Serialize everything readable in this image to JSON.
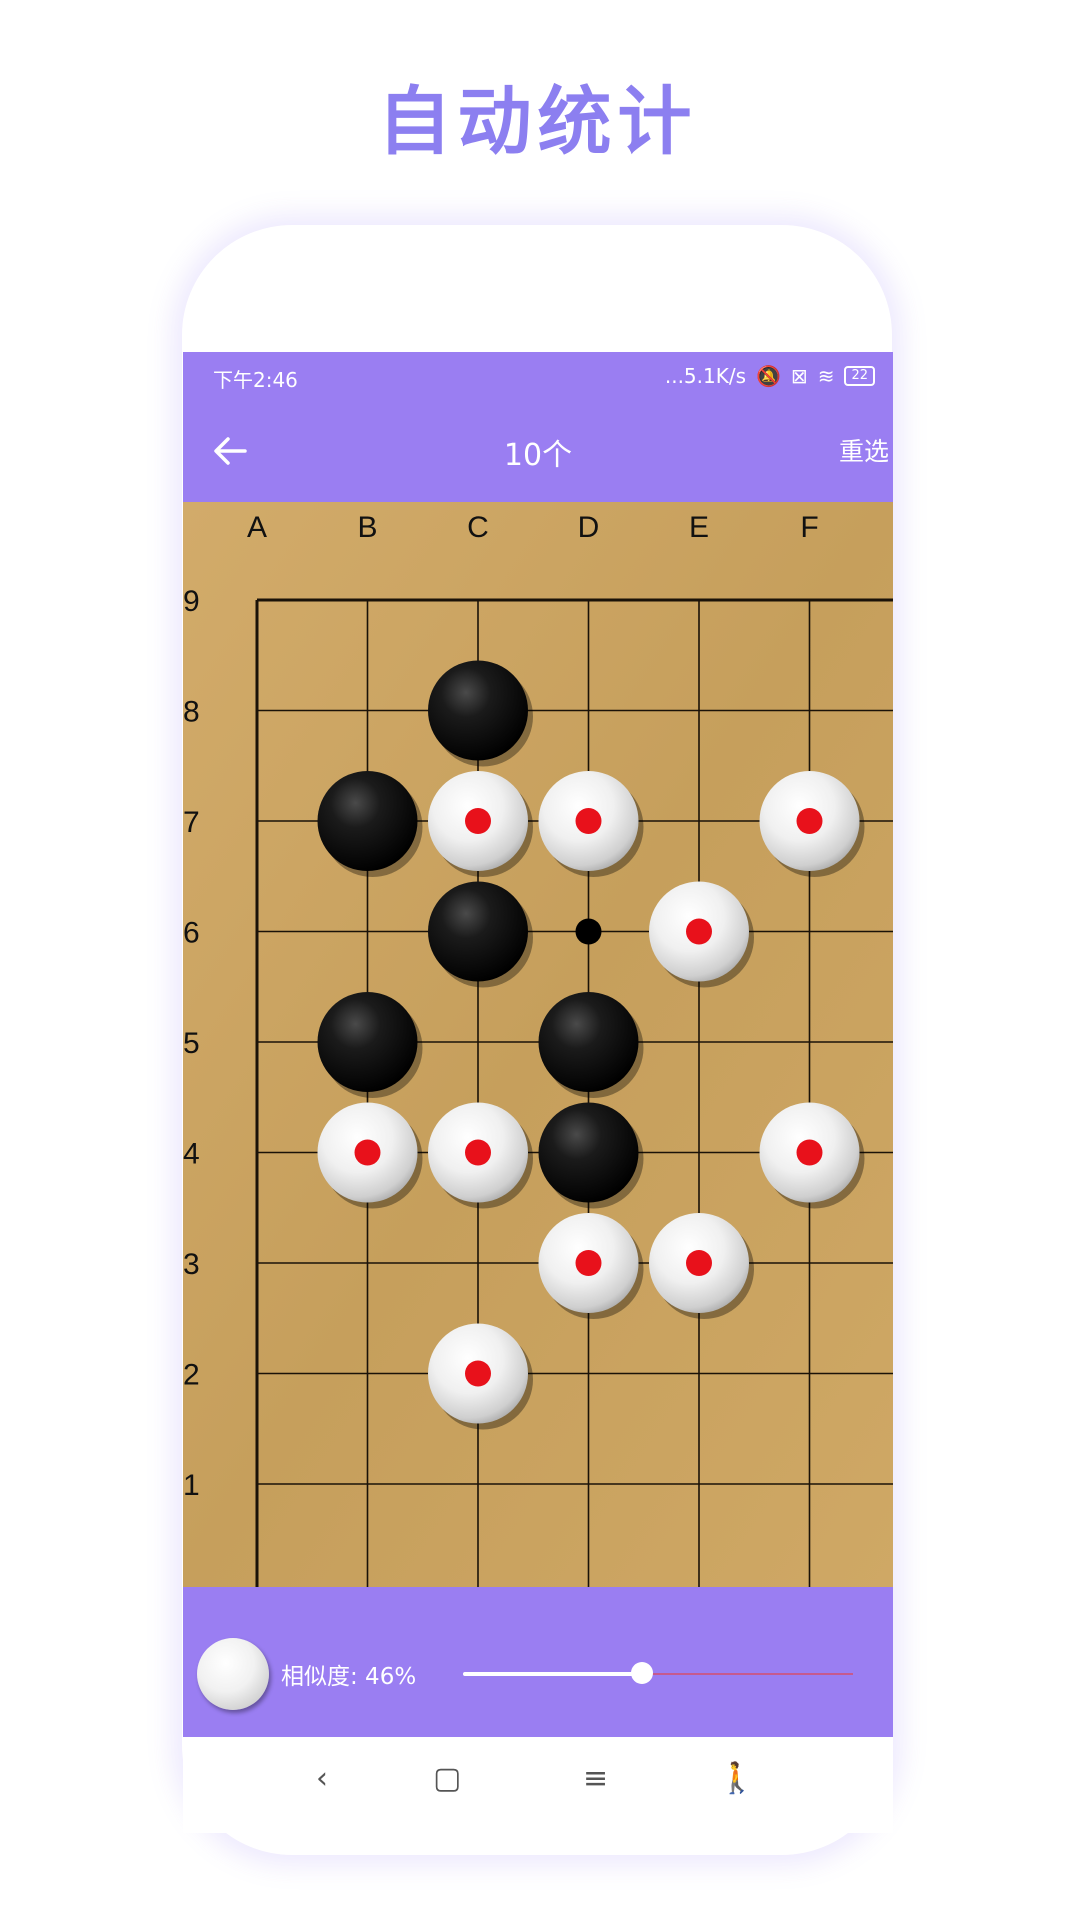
{
  "hero_title": "自动统计",
  "status": {
    "time": "下午2:46",
    "network_speed": "...5.1K/s",
    "battery": "22"
  },
  "appbar": {
    "title": "10个",
    "reselect_label": "重选"
  },
  "board": {
    "columns": [
      "A",
      "B",
      "C",
      "D",
      "E",
      "F"
    ],
    "rows": [
      "9",
      "8",
      "7",
      "6",
      "5",
      "4",
      "3",
      "2",
      "1"
    ],
    "stones": [
      {
        "color": "black",
        "pos": "C8"
      },
      {
        "color": "black",
        "pos": "B7"
      },
      {
        "color": "white",
        "pos": "C7",
        "marked": true
      },
      {
        "color": "white",
        "pos": "D7",
        "marked": true
      },
      {
        "color": "white",
        "pos": "F7",
        "marked": true
      },
      {
        "color": "black",
        "pos": "C6"
      },
      {
        "color": "white",
        "pos": "E6",
        "marked": true
      },
      {
        "color": "black",
        "pos": "B5"
      },
      {
        "color": "black",
        "pos": "D5"
      },
      {
        "color": "white",
        "pos": "B4",
        "marked": true
      },
      {
        "color": "white",
        "pos": "C4",
        "marked": true
      },
      {
        "color": "black",
        "pos": "D4"
      },
      {
        "color": "white",
        "pos": "F4",
        "marked": true
      },
      {
        "color": "white",
        "pos": "D3",
        "marked": true
      },
      {
        "color": "white",
        "pos": "E3",
        "marked": true
      },
      {
        "color": "white",
        "pos": "C2",
        "marked": true
      }
    ],
    "star_points": [
      "D6"
    ]
  },
  "bottom": {
    "similarity_label": "相似度: 46%",
    "similarity_value": 0.46
  },
  "colors": {
    "accent": "#9a7ef2",
    "title_purple": "#8c7ff0",
    "board_wood": "#c9a260",
    "marker_red": "#e8111b"
  }
}
